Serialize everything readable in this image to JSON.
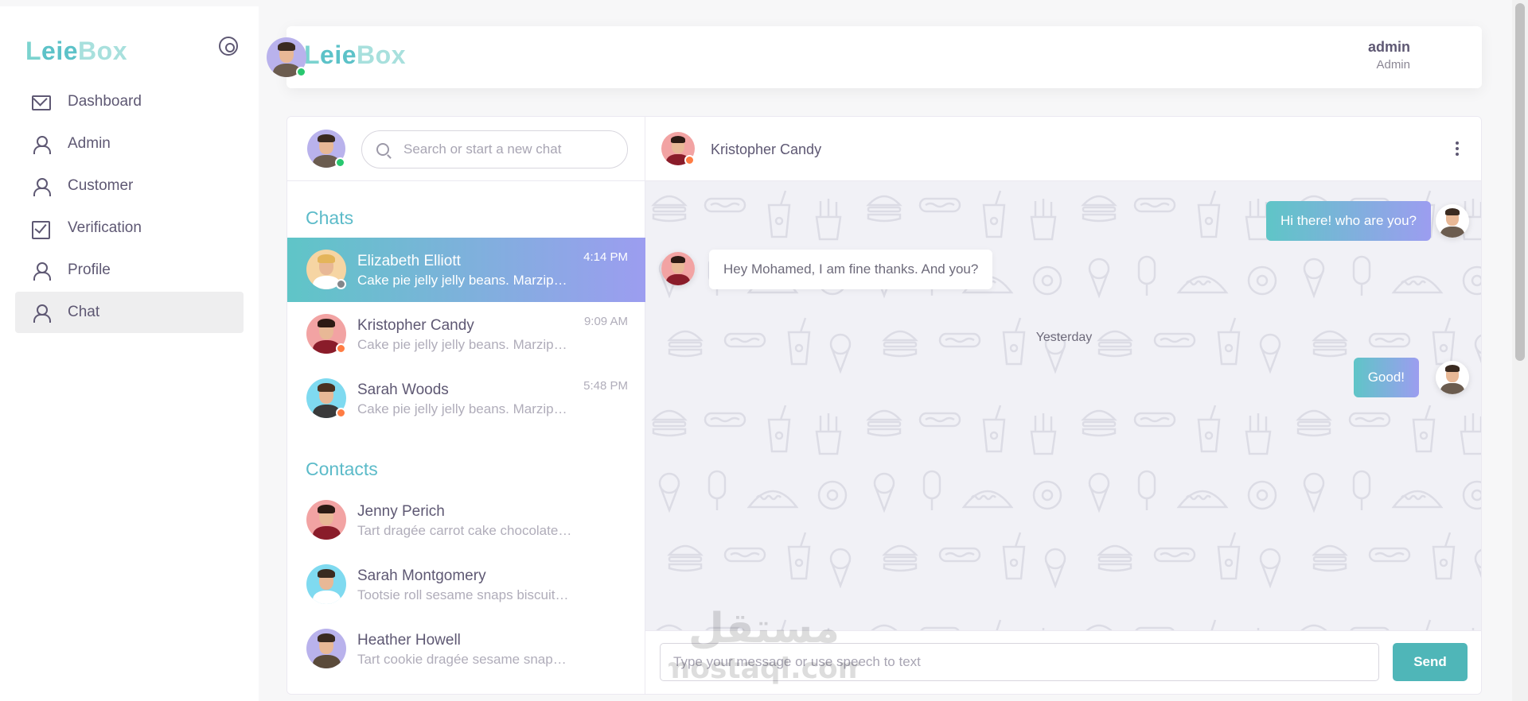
{
  "brand": {
    "name_part1": "L",
    "name_part2": "eie",
    "name_part3": "Box"
  },
  "sidebar": {
    "items": [
      {
        "label": "Dashboard",
        "icon": "mail-icon"
      },
      {
        "label": "Admin",
        "icon": "user-icon"
      },
      {
        "label": "Customer",
        "icon": "user-icon"
      },
      {
        "label": "Verification",
        "icon": "check-square-icon"
      },
      {
        "label": "Profile",
        "icon": "user-icon"
      },
      {
        "label": "Chat",
        "icon": "user-icon",
        "active": true
      }
    ]
  },
  "header": {
    "user_name": "admin",
    "user_role": "Admin"
  },
  "chat": {
    "search_placeholder": "Search or start a new chat",
    "chats_title": "Chats",
    "contacts_title": "Contacts",
    "chats": [
      {
        "name": "Elizabeth Elliott",
        "message": "Cake pie jelly jelly beans. Marzipan lemon drops halvah cake.",
        "time": "4:14 PM",
        "status": "offline",
        "active": true
      },
      {
        "name": "Kristopher Candy",
        "message": "Cake pie jelly jelly beans. Marzipan lemon drops halvah cake.",
        "time": "9:09 AM",
        "status": "away"
      },
      {
        "name": "Sarah Woods",
        "message": "Cake pie jelly jelly beans. Marzipan lemon drops halvah cake.",
        "time": "5:48 PM",
        "status": "away"
      }
    ],
    "contacts": [
      {
        "name": "Jenny Perich",
        "message": "Tart dragée carrot cake chocolate bar."
      },
      {
        "name": "Sarah Montgomery",
        "message": "Tootsie roll sesame snaps biscuit icing."
      },
      {
        "name": "Heather Howell",
        "message": "Tart cookie dragée sesame snaps halvah."
      }
    ],
    "active_contact": "Kristopher Candy",
    "messages": [
      {
        "text": "Hi there! who are you?",
        "direction": "out"
      },
      {
        "text": "Hey Mohamed, I am fine thanks. And you?",
        "direction": "in"
      },
      {
        "text": "Good!",
        "direction": "out"
      }
    ],
    "divider": "Yesterday",
    "composer_placeholder": "Type your message or use speech to text",
    "send_label": "Send"
  },
  "watermark": {
    "line1": "مستقل",
    "line2": "mostaql.com"
  },
  "colors": {
    "accent": "#5cbbc9",
    "gradient_start": "#5fc5c7",
    "gradient_end": "#9c9df0",
    "send": "#4fb6b8"
  }
}
